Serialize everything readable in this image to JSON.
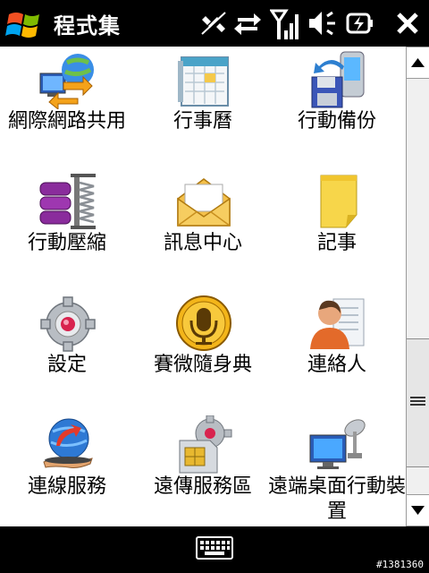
{
  "titlebar": {
    "title": "程式集",
    "start_icon": "windows-flag-icon",
    "status_icons": [
      "connectivity-off-icon",
      "data-transfer-icon",
      "signal-strength-icon",
      "speaker-muted-icon",
      "battery-charging-icon",
      "close-icon"
    ]
  },
  "programs": [
    {
      "label": "網際網路共用",
      "icon": "internet-sharing-icon"
    },
    {
      "label": "行事曆",
      "icon": "calendar-icon"
    },
    {
      "label": "行動備份",
      "icon": "mobile-backup-icon"
    },
    {
      "label": "行動壓縮",
      "icon": "mobile-compression-icon"
    },
    {
      "label": "訊息中心",
      "icon": "messaging-envelope-icon"
    },
    {
      "label": "記事",
      "icon": "notes-icon"
    },
    {
      "label": "設定",
      "icon": "settings-gear-icon"
    },
    {
      "label": "賽微隨身典",
      "icon": "dictionary-icon"
    },
    {
      "label": "連絡人",
      "icon": "contacts-icon"
    },
    {
      "label": "連線服務",
      "icon": "connection-services-icon"
    },
    {
      "label": "遠傳服務區",
      "icon": "sim-services-icon"
    },
    {
      "label": "遠端桌面行動裝置",
      "icon": "remote-desktop-icon"
    }
  ],
  "bottombar": {
    "keyboard_icon": "keyboard-icon",
    "image_id": "#1381360"
  },
  "colors": {
    "bar_background": "#000000",
    "content_background": "#ffffff",
    "text": "#000000"
  }
}
